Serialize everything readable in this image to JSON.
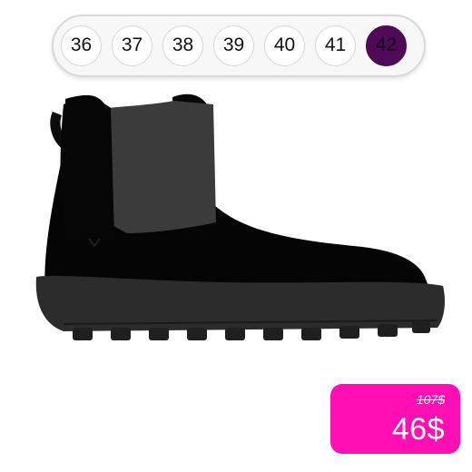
{
  "sizes": {
    "options": [
      "36",
      "37",
      "38",
      "39",
      "40",
      "41",
      "42"
    ],
    "selected": "42"
  },
  "product": {
    "image_icon": "black-chelsea-boot"
  },
  "price": {
    "old": "107$",
    "new": "46$",
    "accent_color": "#ff0fb4",
    "selected_color": "#4e0a56"
  }
}
